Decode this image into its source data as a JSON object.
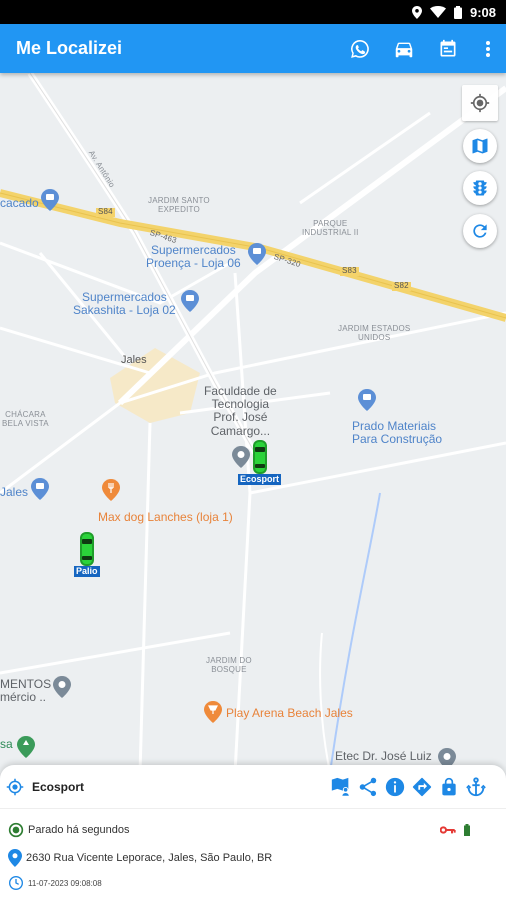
{
  "status_bar": {
    "time": "9:08"
  },
  "app_bar": {
    "title": "Me Localizei",
    "actions": [
      "whatsapp-icon",
      "car-icon",
      "calendar-icon",
      "more-vert-icon"
    ]
  },
  "map": {
    "area_labels": {
      "jardim_santo_expedito": "JARDIM SANTO\nEXPEDITO",
      "parque_industrial": "PARQUE\nINDUSTRIAL II",
      "jardim_estados_unidos": "JARDIM ESTADOS\nUNIDOS",
      "chacara_bela_vista": "CHÁCARA\nBELA VISTA",
      "jardim_do_bosque": "JARDIM DO\nBOSQUE",
      "jales": "Jales"
    },
    "road_labels": {
      "av_antonio": "Av. Antônio",
      "s84": "S84",
      "sp463": "SP-463",
      "sp320": "SP-320",
      "s83": "S83",
      "s82": "S82"
    },
    "places": {
      "cacado": "cacado",
      "proenca": "Supermercados\nProença - Loja 06",
      "sakashita": "Supermercados\nSakashita - Loja 02",
      "faculdade": "Faculdade de\nTecnologia\nProf. José\nCamargo...",
      "prado": "Prado Materiais\nPara Construção",
      "jales_left": "Jales",
      "maxdog": "Max dog Lanches (loja 1)",
      "mentos": "MENTOS\nmércio ..",
      "play_arena": "Play Arena Beach Jales",
      "etec": "Etec Dr. José Luiz",
      "left_sa": "sa"
    },
    "vehicles": [
      {
        "name": "Ecosport",
        "color": "#22c02a"
      },
      {
        "name": "Palio",
        "color": "#22c02a"
      }
    ],
    "controls": [
      "my-location-icon",
      "map-layers-icon",
      "traffic-icon",
      "refresh-icon"
    ]
  },
  "panel": {
    "vehicle_name": "Ecosport",
    "tools": [
      "map-person-icon",
      "share-icon",
      "info-icon",
      "directions-icon",
      "lock-icon",
      "anchor-icon"
    ],
    "status": "Parado há segundos",
    "address": "2630 Rua Vicente Leporace, Jales, São Paulo, BR",
    "timestamp": "11-07-2023 09:08:08"
  },
  "colors": {
    "app_bar": "#2196f3",
    "accent_icons": "#1e88e5",
    "status_ok": "#2e7d32",
    "key_red": "#e53935"
  }
}
